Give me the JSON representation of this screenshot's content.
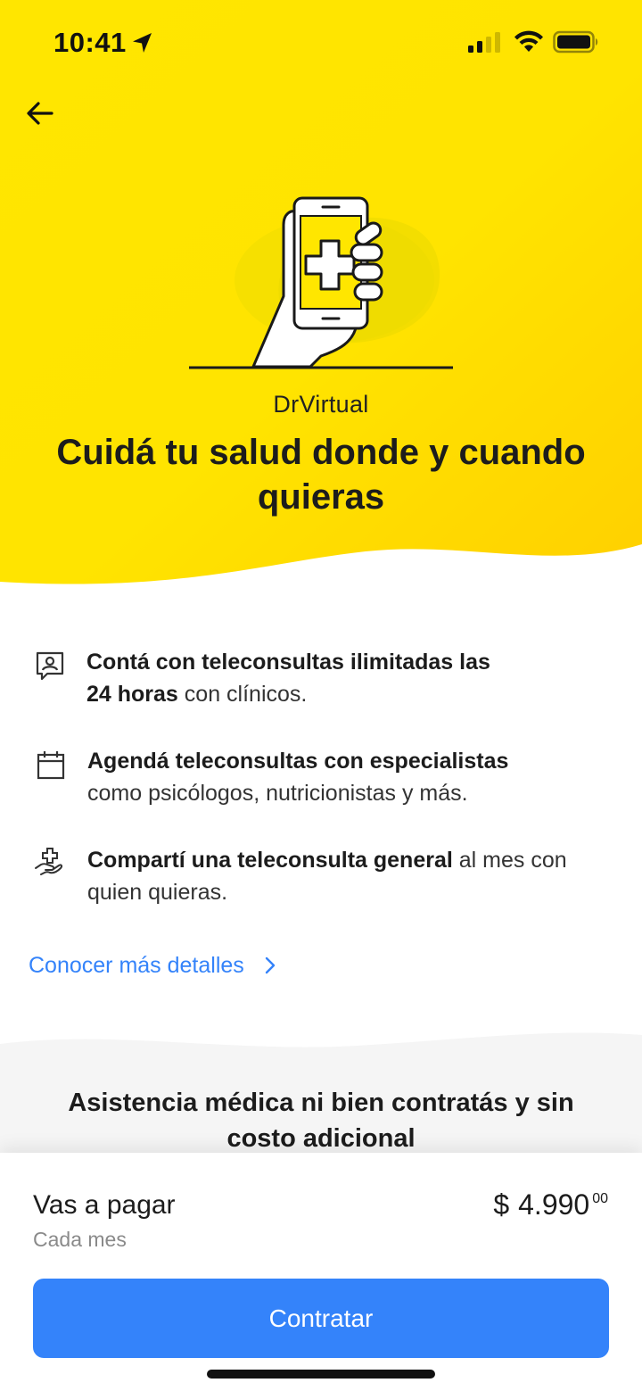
{
  "status_bar": {
    "time": "10:41",
    "icons": [
      "location-arrow-icon",
      "cellular-signal-icon",
      "wifi-icon",
      "battery-icon"
    ]
  },
  "header": {
    "back_icon": "arrow-left-icon",
    "brand": "DrVirtual",
    "title": "Cuidá tu salud donde y cuando quieras"
  },
  "features": [
    {
      "icon": "teleconsult-profile-icon",
      "bold": "Contá con teleconsultas ilimitadas las",
      "bold2": "24 horas",
      "rest": " con clínicos."
    },
    {
      "icon": "calendar-icon",
      "bold": "Agendá teleconsultas con especialistas",
      "rest": "como psicólogos, nutricionistas y más."
    },
    {
      "icon": "hand-plus-icon",
      "bold": "Compartí una teleconsulta general",
      "rest": " al mes con quien quieras."
    }
  ],
  "details_link": {
    "label": "Conocer más detalles",
    "icon": "chevron-right-icon"
  },
  "assistance": {
    "text": "Asistencia médica ni bien contratás y sin costo adicional"
  },
  "payment": {
    "label": "Vas a pagar",
    "period": "Cada mes",
    "currency": "$",
    "amount": "4.990",
    "cents": "00"
  },
  "cta": {
    "label": "Contratar"
  },
  "colors": {
    "brand_yellow": "#FFE600",
    "accent_blue": "#3483FA",
    "text_dark": "#1C1C1C",
    "text_muted": "#8A8A8A",
    "assist_bg": "#F5F5F5"
  }
}
